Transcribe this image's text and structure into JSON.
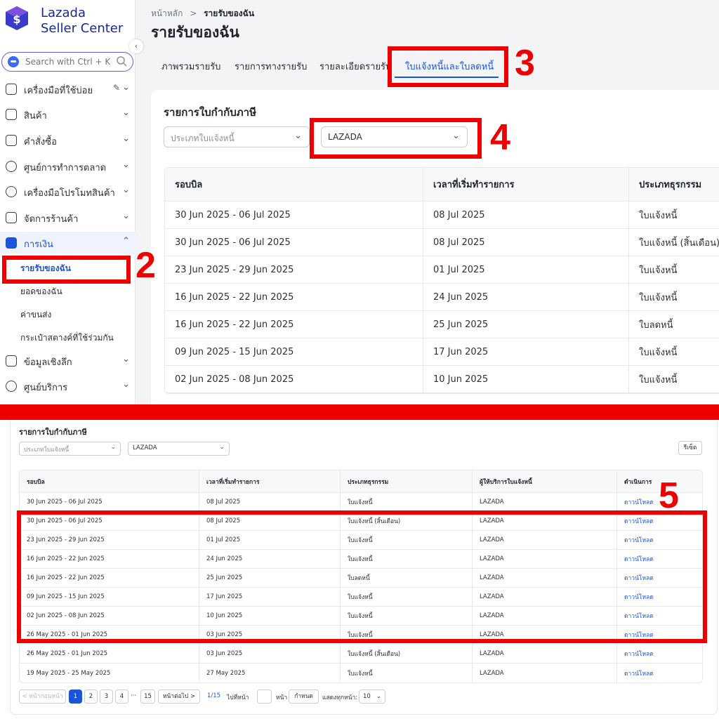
{
  "logo": {
    "line1": "Lazada",
    "line2": "Seller Center",
    "brand_color": "#1a2a8c"
  },
  "search": {
    "placeholder": "Search with Ctrl + K"
  },
  "sidebar": {
    "items": [
      {
        "label": "เครื่องมือที่ใช้บ่อย",
        "icon": "toolbox-icon"
      },
      {
        "label": "สินค้า",
        "icon": "bag-icon"
      },
      {
        "label": "คำสั่งซื้อ",
        "icon": "order-icon"
      },
      {
        "label": "ศูนย์การทำการตลาด",
        "icon": "marketing-icon"
      },
      {
        "label": "เครื่องมือโปรโมทสินค้า",
        "icon": "promo-icon"
      },
      {
        "label": "จัดการร้านค้า",
        "icon": "store-icon"
      },
      {
        "label": "การเงิน",
        "icon": "wallet-icon"
      },
      {
        "label": "ข้อมูลเชิงลึก",
        "icon": "insight-icon"
      },
      {
        "label": "ศูนย์บริการ",
        "icon": "headset-icon"
      }
    ],
    "finance_sub": [
      "รายรับของฉัน",
      "ยอดของฉัน",
      "ค่าขนส่ง",
      "กระเป๋าสตางค์ที่ใช้ร่วมกัน"
    ]
  },
  "breadcrumb": {
    "home": "หน้าหลัก",
    "sep": ">",
    "current": "รายรับของฉัน"
  },
  "page_title": "รายรับของฉัน",
  "tabs": [
    "ภาพรวมรายรับ",
    "รายการทางรายรับ",
    "รายละเอียดรายรับ",
    "ใบแจ้งหนี้และใบลดหนี้"
  ],
  "card": {
    "title": "รายการใบกำกับภาษี",
    "filter_type_placeholder": "ประเภทใบแจ้งหนี้",
    "filter_provider_value": "LAZADA",
    "reset_label": "รีเซ็ต"
  },
  "table_top": {
    "headers": [
      "รอบบิล",
      "เวลาที่เริ่มทำรายการ",
      "ประเภทธุรกรรม"
    ],
    "rows": [
      [
        "30 Jun 2025 - 06 Jul 2025",
        "08 Jul 2025",
        "ใบแจ้งหนี้"
      ],
      [
        "30 Jun 2025 - 06 Jul 2025",
        "08 Jul 2025",
        "ใบแจ้งหนี้ (สิ้นเดือน)"
      ],
      [
        "23 Jun 2025 - 29 Jun 2025",
        "01 Jul 2025",
        "ใบแจ้งหนี้"
      ],
      [
        "16 Jun 2025 - 22 Jun 2025",
        "24 Jun 2025",
        "ใบแจ้งหนี้"
      ],
      [
        "16 Jun 2025 - 22 Jun 2025",
        "25 Jun 2025",
        "ใบลดหนี้"
      ],
      [
        "09 Jun 2025 - 15 Jun 2025",
        "17 Jun 2025",
        "ใบแจ้งหนี้"
      ],
      [
        "02 Jun 2025 - 08 Jun 2025",
        "10 Jun 2025",
        "ใบแจ้งหนี้"
      ]
    ]
  },
  "table_bottom": {
    "headers": [
      "รอบบิล",
      "เวลาที่เริ่มทำรายการ",
      "ประเภทธุรกรรม",
      "ผู้ให้บริการใบแจ้งหนี้",
      "ดำเนินการ"
    ],
    "rows": [
      [
        "30 Jun 2025 - 06 Jul 2025",
        "08 Jul 2025",
        "ใบแจ้งหนี้",
        "LAZADA",
        "ดาวน์โหลด"
      ],
      [
        "30 Jun 2025 - 06 Jul 2025",
        "08 Jul 2025",
        "ใบแจ้งหนี้ (สิ้นเดือน)",
        "LAZADA",
        "ดาวน์โหลด"
      ],
      [
        "23 Jun 2025 - 29 Jun 2025",
        "01 Jul 2025",
        "ใบแจ้งหนี้",
        "LAZADA",
        "ดาวน์โหลด"
      ],
      [
        "16 Jun 2025 - 22 Jun 2025",
        "24 Jun 2025",
        "ใบแจ้งหนี้",
        "LAZADA",
        "ดาวน์โหลด"
      ],
      [
        "16 Jun 2025 - 22 Jun 2025",
        "25 Jun 2025",
        "ใบลดหนี้",
        "LAZADA",
        "ดาวน์โหลด"
      ],
      [
        "09 Jun 2025 - 15 Jun 2025",
        "17 Jun 2025",
        "ใบแจ้งหนี้",
        "LAZADA",
        "ดาวน์โหลด"
      ],
      [
        "02 Jun 2025 - 08 Jun 2025",
        "10 Jun 2025",
        "ใบแจ้งหนี้",
        "LAZADA",
        "ดาวน์โหลด"
      ],
      [
        "26 May 2025 - 01 Jun 2025",
        "03 Jun 2025",
        "ใบแจ้งหนี้",
        "LAZADA",
        "ดาวน์โหลด"
      ],
      [
        "26 May 2025 - 01 Jun 2025",
        "03 Jun 2025",
        "ใบแจ้งหนี้ (สิ้นเดือน)",
        "LAZADA",
        "ดาวน์โหลด"
      ],
      [
        "19 May 2025 - 25 May 2025",
        "27 May 2025",
        "ใบแจ้งหนี้",
        "LAZADA",
        "ดาวน์โหลด"
      ]
    ]
  },
  "pagination": {
    "prev": "< หน้าก่อนหน้า",
    "pages": [
      "1",
      "2",
      "3",
      "4"
    ],
    "ellipsis": "···",
    "last": "15",
    "next": "หน้าต่อไป >",
    "total": "1/15",
    "goto_label": "ไปที่หน้า",
    "goto_suffix": "หน้า",
    "confirm": "กำหนด",
    "per_page_label": "แสดงทุกหน้า:",
    "per_page_value": "10"
  },
  "annotations": [
    "2",
    "3",
    "4",
    "5"
  ],
  "colors": {
    "accent": "#1a55d6",
    "annotation_red": "#ee0000"
  }
}
